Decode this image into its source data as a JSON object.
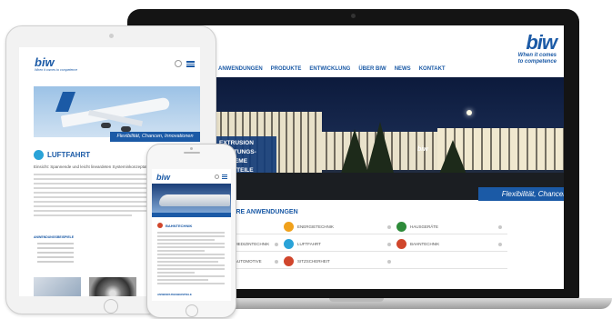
{
  "laptop": {
    "logo": {
      "word": "biw",
      "tagline_1": "When it comes",
      "tagline_2": "to competence"
    },
    "nav": [
      "ANWENDUNGEN",
      "PRODUKTE",
      "ENTWICKLUNG",
      "ÜBER BIW",
      "NEWS",
      "KONTAKT"
    ],
    "hero": {
      "building_logo": "biw",
      "left_lines": [
        "EXTRUSION",
        "DICHTUNGS-SYSTEME",
        "FORMTEILE"
      ],
      "banner": "Flexibilität, Chancen, Innovationen"
    },
    "section_title": "UNSERE ANWENDUNGEN",
    "grid": [
      {
        "label": "",
        "icon": "blank",
        "color": "#ffffff"
      },
      {
        "label": "ENERGIETECHNIK",
        "icon": "energy-icon",
        "color": "#f0a11c"
      },
      {
        "label": "HAUSGERÄTE",
        "icon": "appliance-icon",
        "color": "#2e8b3a"
      },
      {
        "label": "MEDIZINTECHNIK",
        "icon": "medical-icon",
        "color": "#6fae2f"
      },
      {
        "label": "LUFTFAHRT",
        "icon": "aviation-icon",
        "color": "#2aa3d8"
      },
      {
        "label": "BAHNTECHNIK",
        "icon": "rail-icon",
        "color": "#d0462c"
      },
      {
        "label": "AUTOMOTIVE",
        "icon": "car-icon",
        "color": "#1b5aa6"
      },
      {
        "label": "SITZSCHERHEIT",
        "icon": "seat-icon",
        "color": "#d0462c"
      },
      {
        "label": "",
        "icon": "blank",
        "color": "#ffffff"
      }
    ]
  },
  "tablet": {
    "logo": {
      "word": "biw",
      "tagline": "When it comes to competence"
    },
    "hero_banner": "Flexibilität, Chancen, Innovationen",
    "section_title": "LUFTFAHRT",
    "subtitle": "Einsicht: Spannende und leicht lineardeten Systeminkonzeptation",
    "list_label": "ANWENDUNGSBEISPIELE"
  },
  "phone": {
    "logo": "biw",
    "section_title": "BAHNTECHNIK",
    "footer_label": "ANWENDUNGSBEISPIELE"
  }
}
